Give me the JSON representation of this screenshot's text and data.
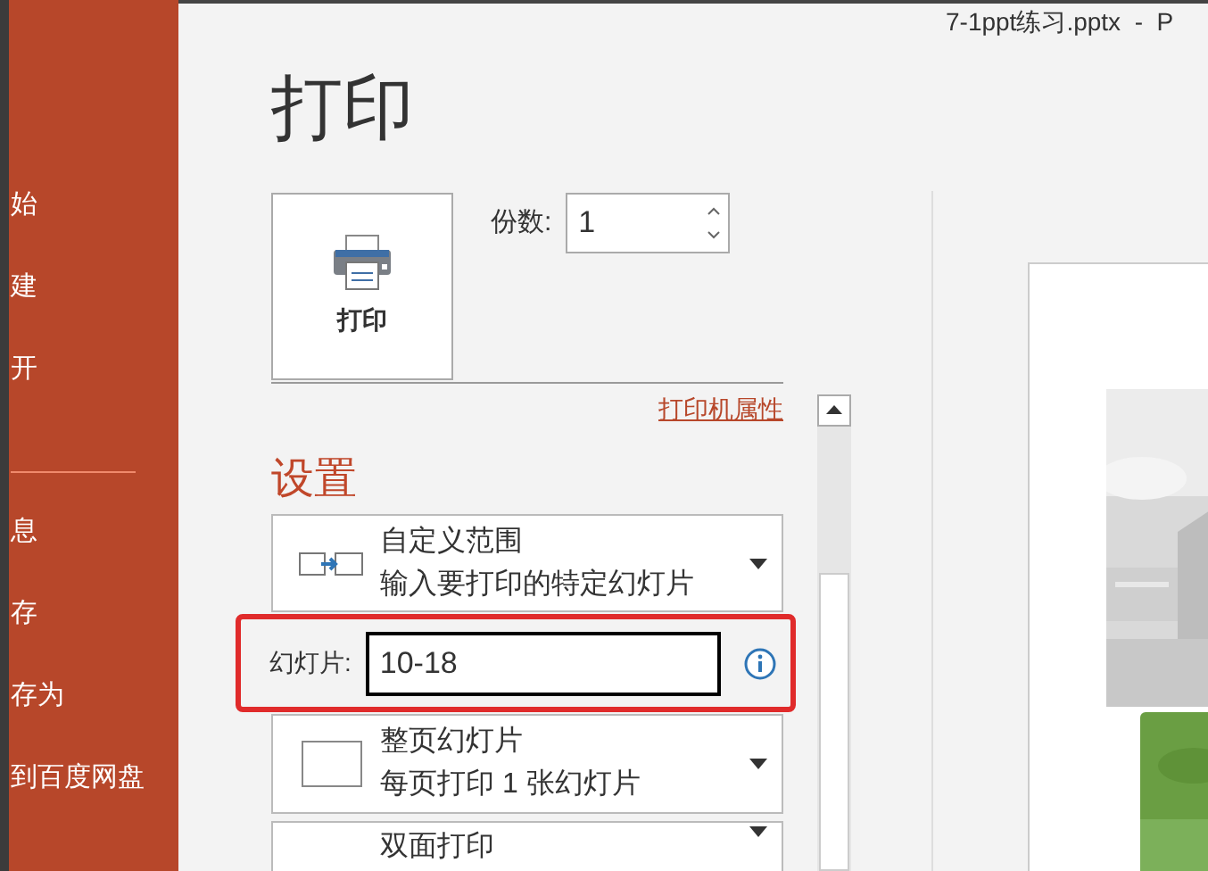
{
  "window": {
    "title": "7-1ppt练习.pptx  -  P"
  },
  "sidebar": {
    "items": [
      {
        "label": "始"
      },
      {
        "label": "建"
      },
      {
        "label": "开"
      },
      {
        "label": "息",
        "divider_before": true
      },
      {
        "label": "存"
      },
      {
        "label": "存为"
      },
      {
        "label": "到百度网盘"
      }
    ]
  },
  "print": {
    "heading": "打印",
    "button": "打印",
    "copies_label": "份数:",
    "copies_value": "1",
    "printer_properties": "打印机属性"
  },
  "settings": {
    "heading": "设置",
    "dropdowns": [
      {
        "title": "自定义范围",
        "subtitle": "输入要打印的特定幻灯片",
        "kind": "range"
      },
      {
        "title": "整页幻灯片",
        "subtitle": "每页打印 1 张幻灯片",
        "kind": "page"
      },
      {
        "title": "双面打印",
        "kind": "plain"
      }
    ],
    "slides_label": "幻灯片:",
    "slides_value": "10-18"
  }
}
